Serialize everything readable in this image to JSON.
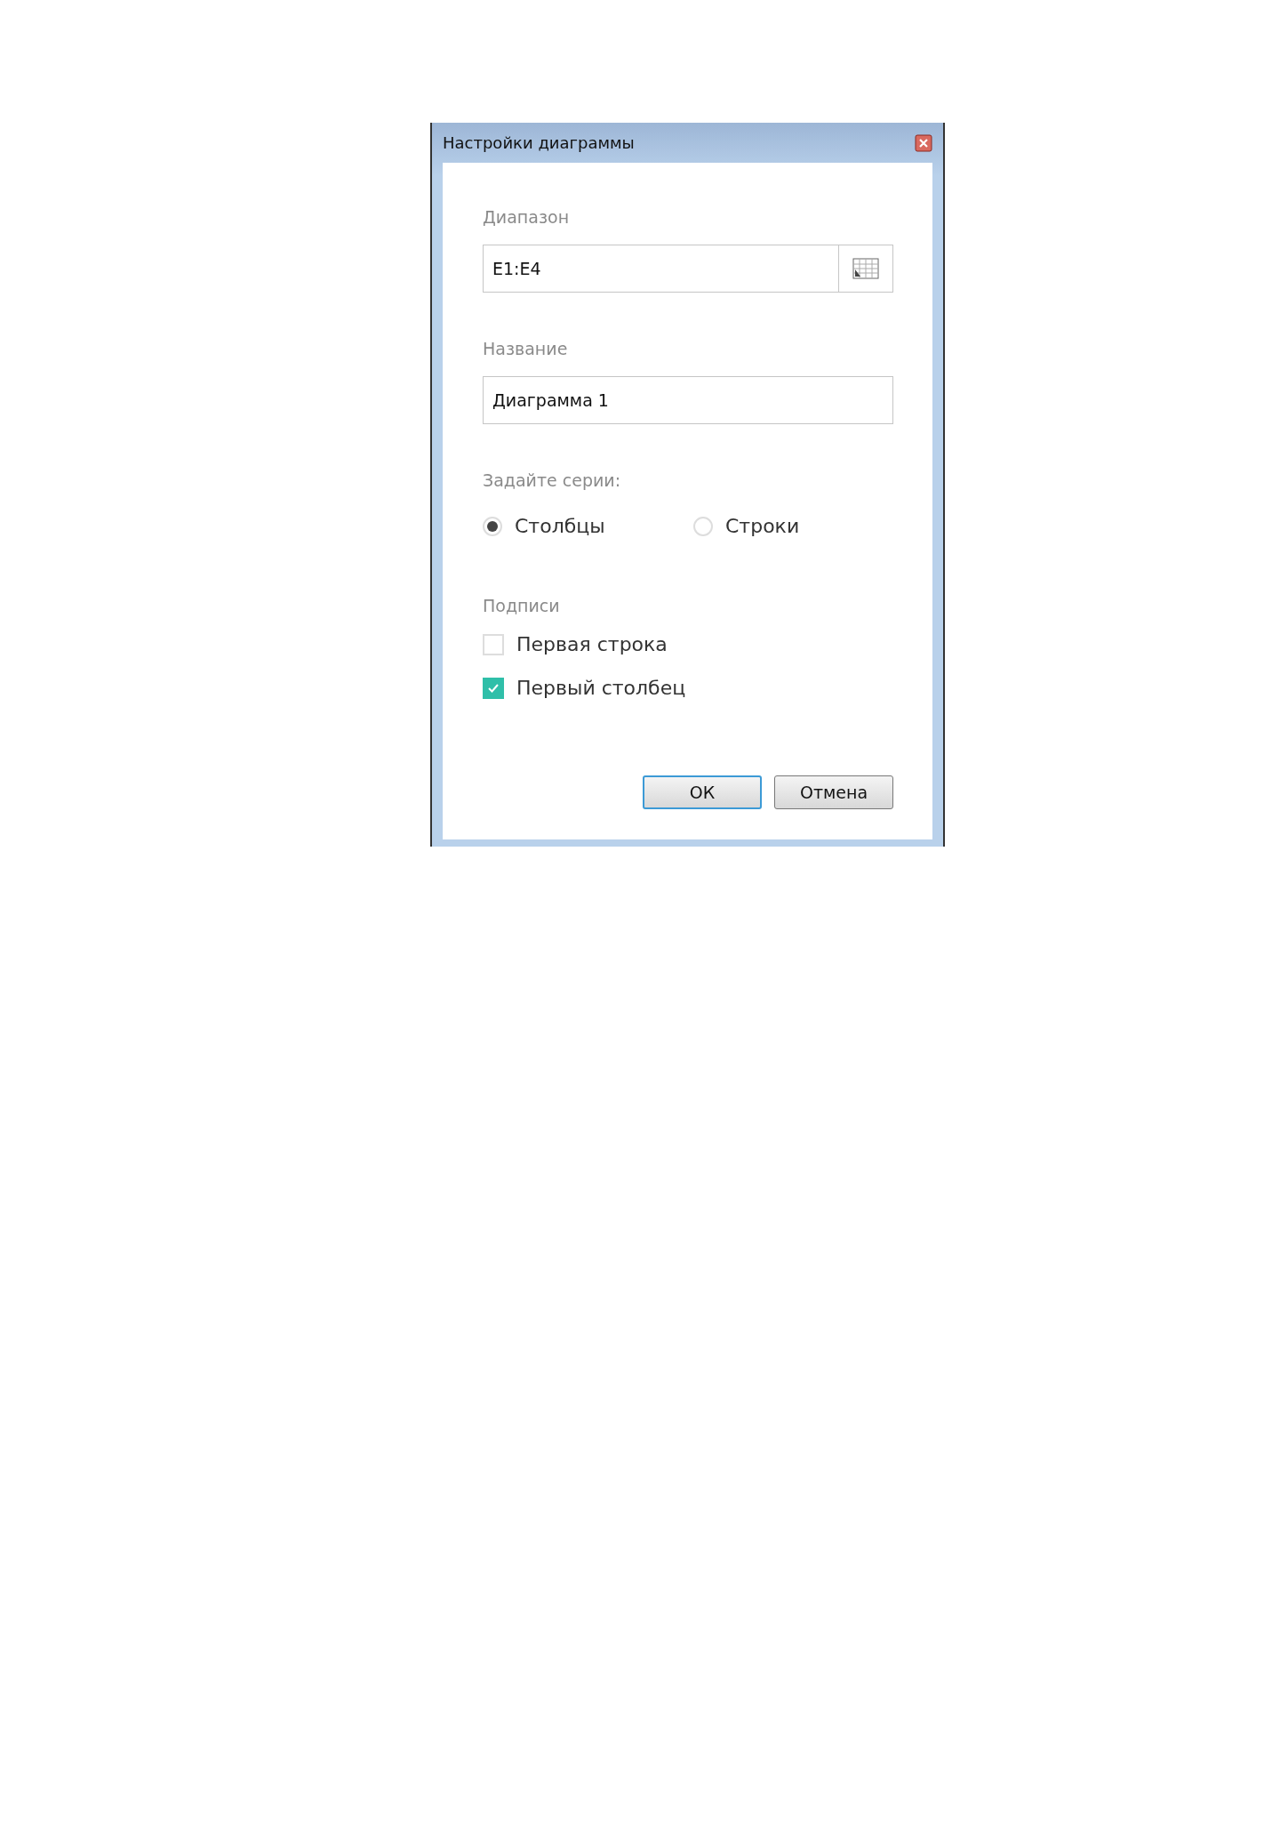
{
  "window": {
    "title": "Настройки диаграммы"
  },
  "range": {
    "label": "Диапазон",
    "value": "E1:E4"
  },
  "name": {
    "label": "Название",
    "value": "Диаграмма 1"
  },
  "series": {
    "label": "Задайте серии:",
    "options": [
      {
        "label": "Столбцы",
        "selected": true
      },
      {
        "label": "Строки",
        "selected": false
      }
    ]
  },
  "captions": {
    "label": "Подписи",
    "options": [
      {
        "label": "Первая строка",
        "checked": false
      },
      {
        "label": "Первый столбец",
        "checked": true
      }
    ]
  },
  "buttons": [
    {
      "label": "ОК",
      "kind": "default"
    },
    {
      "label": "Отмена",
      "kind": "normal"
    }
  ]
}
